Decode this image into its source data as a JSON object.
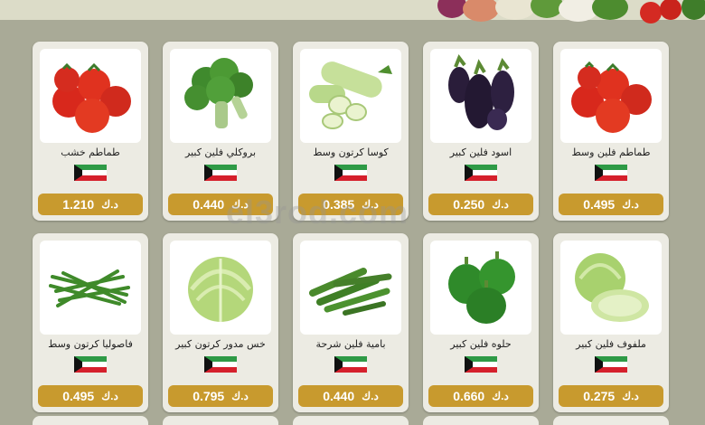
{
  "watermark": "el3rod.com",
  "colors": {
    "price_bg": "#c89a2e",
    "card_bg": "#ecebe3",
    "page_bg": "#a9aa97"
  },
  "products": [
    {
      "name": "طماطم خشب",
      "price": "1.210",
      "currency": "د.ك",
      "icon": "tomatoes-icon"
    },
    {
      "name": "بروكلي فلين كبير",
      "price": "0.440",
      "currency": "د.ك",
      "icon": "broccoli-icon"
    },
    {
      "name": "كوسا كرتون وسط",
      "price": "0.385",
      "currency": "د.ك",
      "icon": "zucchini-icon"
    },
    {
      "name": "اسود فلين كبير",
      "price": "0.250",
      "currency": "د.ك",
      "icon": "eggplant-icon"
    },
    {
      "name": "طماطم فلين وسط",
      "price": "0.495",
      "currency": "د.ك",
      "icon": "tomatoes-icon"
    },
    {
      "name": "فاصوليا كرتون وسط",
      "price": "0.495",
      "currency": "د.ك",
      "icon": "green-beans-icon"
    },
    {
      "name": "خس مدور كرتون كبير",
      "price": "0.795",
      "currency": "د.ك",
      "icon": "lettuce-icon"
    },
    {
      "name": "بامية فلين شرحة",
      "price": "0.440",
      "currency": "د.ك",
      "icon": "okra-icon"
    },
    {
      "name": "حلوه فلين كبير",
      "price": "0.660",
      "currency": "د.ك",
      "icon": "green-pepper-icon"
    },
    {
      "name": "ملفوف فلين كبير",
      "price": "0.275",
      "currency": "د.ك",
      "icon": "cabbage-icon"
    }
  ]
}
